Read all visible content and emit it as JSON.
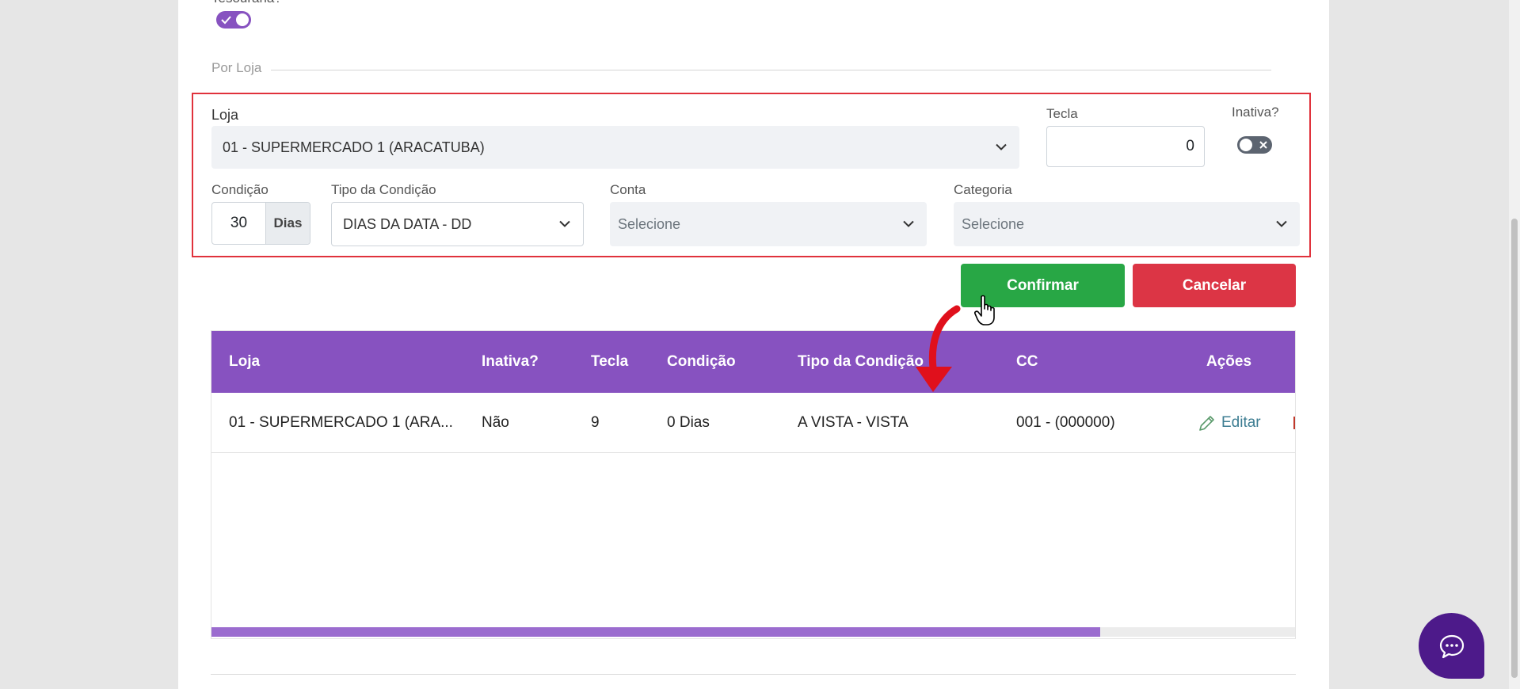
{
  "top_section": {
    "tesouraria_label": "Tesouraria?",
    "por_loja_label": "Por Loja"
  },
  "form": {
    "loja_label": "Loja",
    "loja_value": "01 - SUPERMERCADO 1 (ARACATUBA)",
    "tecla_label": "Tecla",
    "tecla_value": "0",
    "inativa_label": "Inativa?",
    "condicao_label": "Condição",
    "condicao_value": "30",
    "condicao_suffix": "Dias",
    "tipo_label": "Tipo da Condição",
    "tipo_value": "DIAS DA DATA - DD",
    "conta_label": "Conta",
    "conta_placeholder": "Selecione",
    "categoria_label": "Categoria",
    "categoria_placeholder": "Selecione"
  },
  "buttons": {
    "confirm": "Confirmar",
    "cancel": "Cancelar"
  },
  "table": {
    "headers": {
      "loja": "Loja",
      "inativa": "Inativa?",
      "tecla": "Tecla",
      "condicao": "Condição",
      "tipo": "Tipo da Condição",
      "cc": "CC",
      "acoes": "Ações"
    },
    "rows": [
      {
        "loja": "01 - SUPERMERCADO 1 (ARA...",
        "inativa": "Não",
        "tecla": "9",
        "condicao": "0 Dias",
        "tipo": "A VISTA - VISTA",
        "cc": "001 - (000000)",
        "edit": "Editar"
      }
    ],
    "hscroll_fraction": 0.82
  },
  "colors": {
    "purple": "#8752c0",
    "green": "#28a745",
    "red": "#dc3545",
    "highlight": "#e0323c",
    "chat": "#4d1a8a"
  },
  "icons": [
    "check-icon",
    "close-icon",
    "chevron-down-icon",
    "pencil-icon",
    "chat-icon",
    "hand-cursor-icon",
    "arrow-annotation-icon"
  ]
}
